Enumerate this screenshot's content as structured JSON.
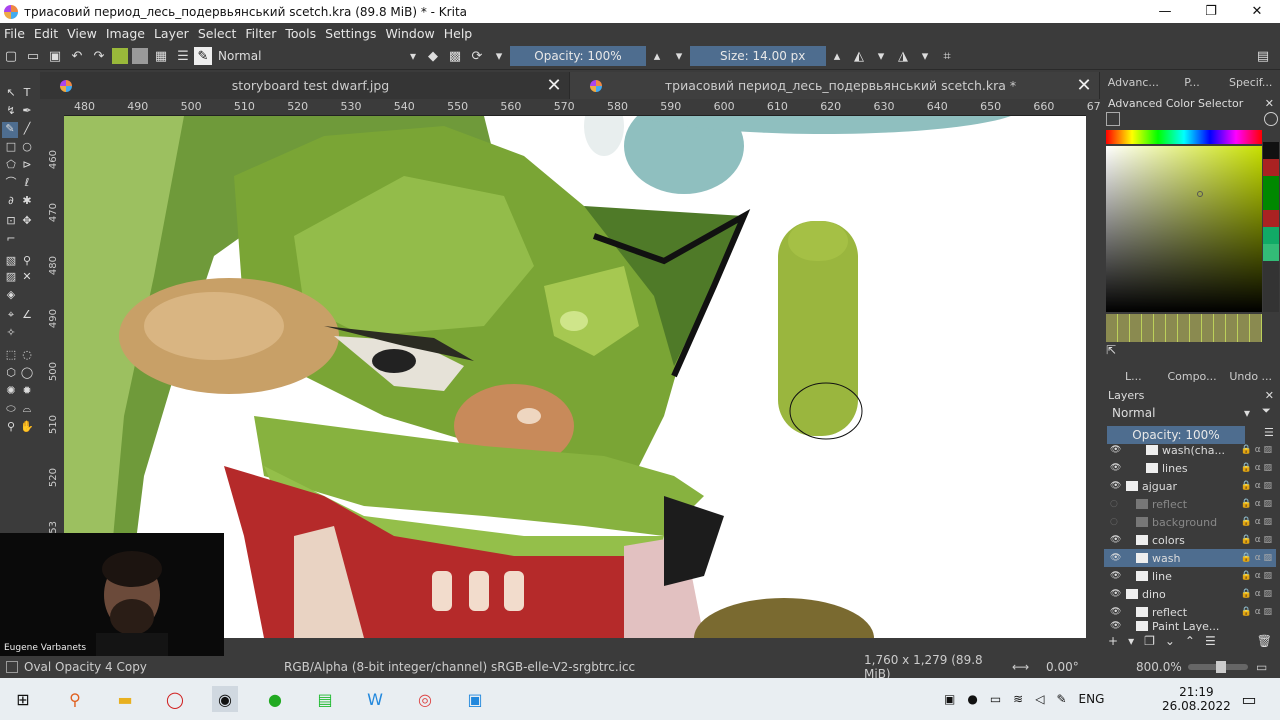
{
  "window": {
    "title": "триасовий период_лесь_подервьянський scetch.kra (89.8 MiB)  * - Krita",
    "minimize": "—",
    "maximize": "❐",
    "close": "✕"
  },
  "menu": [
    "File",
    "Edit",
    "View",
    "Image",
    "Layer",
    "Select",
    "Filter",
    "Tools",
    "Settings",
    "Window",
    "Help"
  ],
  "toolbar": {
    "blend_mode": "Normal",
    "opacity": "Opacity: 100%",
    "size": "Size: 14.00 px",
    "fg_color": "#99b83a",
    "bg_color": "#9a9a9a"
  },
  "tabs": [
    {
      "label": "storyboard test dwarf.jpg",
      "close": "✕"
    },
    {
      "label": "триасовий период_лесь_подервьянський scetch.kra *",
      "close": "✕"
    }
  ],
  "ruler_h": [
    "480",
    "490",
    "500",
    "510",
    "520",
    "530",
    "540",
    "550",
    "560",
    "570",
    "580",
    "590",
    "600",
    "610",
    "620",
    "630",
    "640",
    "650",
    "660",
    "67"
  ],
  "ruler_v": [
    "460",
    "470",
    "480",
    "490",
    "500",
    "510",
    "520",
    "53"
  ],
  "webcam": {
    "name": "Eugene Varbanets"
  },
  "docker": {
    "top_tabs": [
      "Advanc...",
      "P...",
      "Specif..."
    ],
    "color_selector_title": "Advanced Color Selector",
    "mid_tabs": [
      "L...",
      "Compo...",
      "Undo ..."
    ],
    "layers_title": "Layers",
    "blend_mode": "Normal",
    "opacity": "Opacity:  100%",
    "layers": [
      {
        "name": "wash(cha...",
        "indent": 2,
        "dim": false,
        "selected": false
      },
      {
        "name": "lines",
        "indent": 2,
        "dim": false,
        "selected": false
      },
      {
        "name": "ajguar",
        "indent": 0,
        "dim": false,
        "selected": false
      },
      {
        "name": "reflect",
        "indent": 1,
        "dim": true,
        "selected": false
      },
      {
        "name": "background",
        "indent": 1,
        "dim": true,
        "selected": false
      },
      {
        "name": "colors",
        "indent": 1,
        "dim": false,
        "selected": false
      },
      {
        "name": "wash",
        "indent": 1,
        "dim": false,
        "selected": true
      },
      {
        "name": "line",
        "indent": 1,
        "dim": false,
        "selected": false
      },
      {
        "name": "dino",
        "indent": 0,
        "dim": false,
        "selected": false
      },
      {
        "name": "reflect",
        "indent": 1,
        "dim": false,
        "selected": false
      },
      {
        "name": "Paint Laye...",
        "indent": 1,
        "dim": false,
        "selected": false
      }
    ]
  },
  "status": {
    "layer": "Oval Opacity 4 Copy",
    "color_space": "RGB/Alpha (8-bit integer/channel)  sRGB-elle-V2-srgbtrc.icc",
    "dimensions": "1,760 x 1,279 (89.8 MiB)",
    "rotation": "0.00°",
    "zoom": "800.0%"
  },
  "taskbar": {
    "lang": "ENG",
    "time": "21:19",
    "date": "26.08.2022"
  }
}
